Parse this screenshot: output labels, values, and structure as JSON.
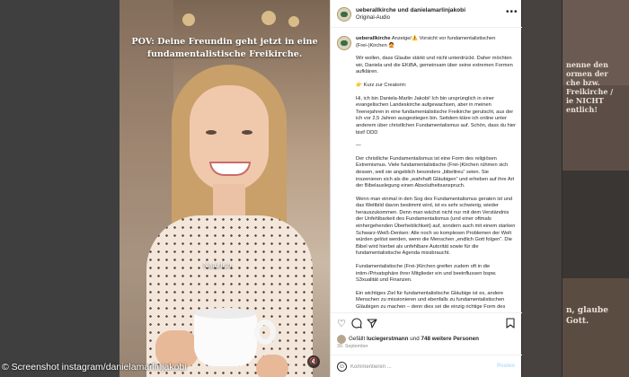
{
  "background_feed": {
    "tile_text_1": [
      "nenne den",
      "ormen der",
      "che bzw.",
      "Freikirche /",
      "ie NICHT",
      "entlich!"
    ],
    "tile_text_2": [
      "n, glaube",
      "Gott."
    ]
  },
  "post": {
    "photo": {
      "caption": "POV: Deine Freundin geht jetzt in eine fundamentalistische Freikirche.",
      "overlay_label": "Natürlich.",
      "mute_icon": "speaker-muted-icon"
    },
    "header": {
      "usernames": "ueberallkirche und danielamarlinjakobi",
      "audio": "Original-Audio",
      "more_icon": "more-horizontal-icon"
    },
    "caption_text": {
      "username": "ueberallkirche",
      "p1": "Anzeige/⚠️ Vorsicht vor fundamentalistischen (Frei-)Kirchen 🙅",
      "p2": "Wir wollen, dass Glaube stärkt und nicht unterdrückt. Daher möchten wir, Daniela und die EKiBA, gemeinsam über seine extremen Formen aufklären.",
      "p3": "👉 Kurz zur Creatorin:",
      "p4": "Hi, ich bin Daniela-Marlin Jakobi! Ich bin ursprünglich in einer evangelischen Landeskirche aufgewachsen, aber in meinen Teenejahren in eine fundamentalistische Freikirche gerutscht, aus der ich vor 2,5 Jahren ausgestiegen bin. Seitdem kläre ich online unter anderem über christlichen Fundamentalismus auf. Schön, dass du hier bist! DDD",
      "p5": "—",
      "p6": "Der christliche Fundamentalismus ist eine Form des religiösen Extremismus. Viele fundamentalistische (Frei-)Kirchen rühmen sich dessen, weil sie angeblich besonders „bibeltreu“ seien. Sie inszenieren sich als die „wahrhaft Gläubigen“ und erheben auf ihre Art der Bibelauslegung einen Absolutheitsanspruch.",
      "p7": "Wenn man einmal in den Sog des Fundamentalismus geraten ist und das Weltbild davon bestimmt wird, ist es sehr schwierig, wieder herauszukommen. Denn man wächst nicht nur mit dem Verständnis der Unfehlbarkeit des Fundamentalismus (und einer oftmals einhergehenden Überheblichkeit) auf, sondern auch mit einem starken Schwarz-Weiß-Denken: Alle noch so komplexen Problemen der Welt würden gelöst werden, wenn die Menschen „endlich Gott folgen“. Die Bibel wird hierbei als unfehlbare Autorität sowie für die fundamentalistische Agenda missbraucht.",
      "p8": "Fundamentalistische (Frei-)Kirchen greifen zudem oft in die intim-/Privatsphäre ihrer Mitglieder ein und beeinflussen bspw. S3xualität und Finanzen.",
      "p9": "Ein wichtiges Ziel für fundamentalistische Gläubige ist es, andere Menschen zu missionieren und ebenfalls zu fundamentalistischen Gläubigen zu machen – denn dies sei die einzig richtige Form des Glaubens."
    },
    "actions": {
      "like_icon": "heart-icon",
      "comment_icon": "comment-icon",
      "share_icon": "share-icon",
      "save_icon": "bookmark-icon",
      "likes_prefix": "Gefällt",
      "likes_user": "luciegerstmann",
      "likes_mid": "und",
      "likes_count": "748 weitere Personen",
      "date": "30. September"
    },
    "comment": {
      "emoji_icon": "emoji-icon",
      "placeholder": "Kommentieren ...",
      "post_label": "Posten"
    }
  },
  "credit": "© Screenshot instagram/danielamarlinjakobi"
}
